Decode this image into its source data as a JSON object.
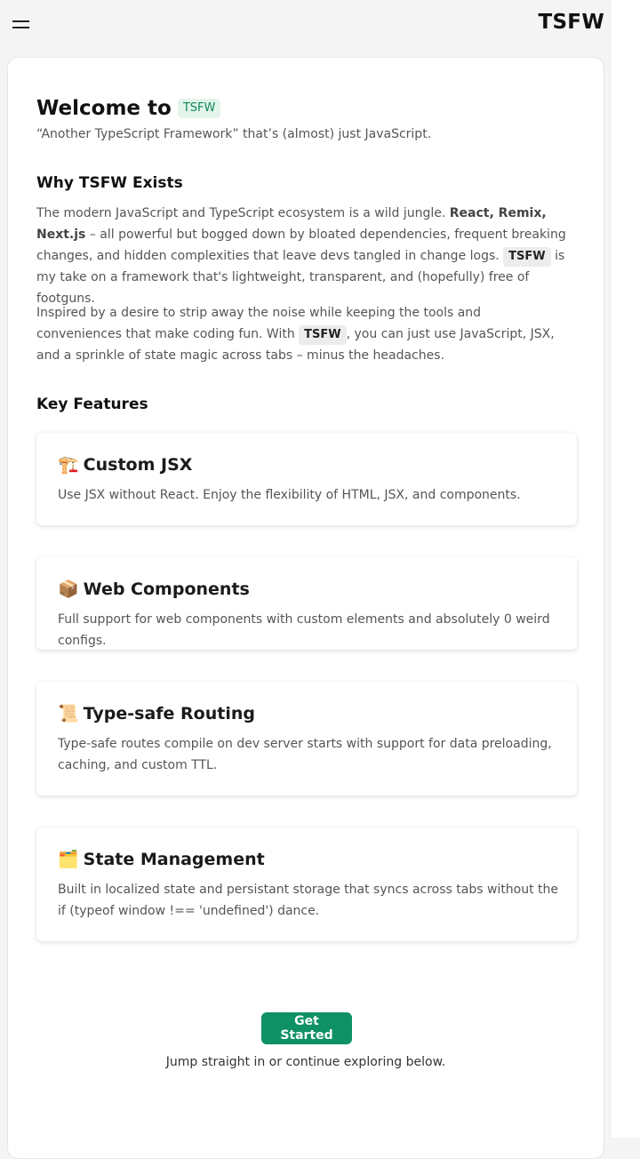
{
  "header": {
    "brand": "TSFW"
  },
  "welcome": {
    "title": "Welcome to",
    "badge": "TSFW",
    "tagline": "“Another TypeScript Framework” that’s (almost) just JavaScript."
  },
  "why": {
    "heading": "Why TSFW Exists",
    "p1_a": "The modern JavaScript and TypeScript ecosystem is a wild jungle.",
    "p1_bold": "React, Remix, Next.js",
    "p1_b": "– all powerful but bogged down by bloated dependencies, frequent breaking changes, and hidden complexities that leave devs tangled in change logs.",
    "p1_code": "TSFW",
    "p1_c": "is my take on a framework that's lightweight, transparent, and (hopefully) free of footguns.",
    "p2_a": "Inspired by a desire to strip away the noise while keeping the tools and conveniences that make coding fun. With",
    "p2_code": "TSFW",
    "p2_b": ", you can just use JavaScript, JSX, and a sprinkle of state magic across tabs – minus the headaches."
  },
  "features": {
    "heading": "Key Features",
    "items": [
      {
        "icon": "🏗️",
        "title": "Custom JSX",
        "desc": "Use JSX without React. Enjoy the flexibility of HTML, JSX, and components."
      },
      {
        "icon": "📦",
        "title": "Web Components",
        "desc": "Full support for web components with custom elements and absolutely 0 weird configs."
      },
      {
        "icon": "📜",
        "title": "Type-safe Routing",
        "desc": "Type-safe routes compile on dev server starts with support for data preloading, caching, and custom TTL."
      },
      {
        "icon": "🗂️",
        "title": "State Management",
        "desc": "Built in localized state and persistant storage that syncs across tabs without the if (typeof window !== 'undefined') dance."
      }
    ]
  },
  "cta": {
    "button": "Get Started",
    "subtext": "Jump straight in or continue exploring below."
  },
  "colors": {
    "accent": "#0e9165",
    "badge_bg": "#e3f4ea",
    "badge_text": "#0f8a58"
  }
}
